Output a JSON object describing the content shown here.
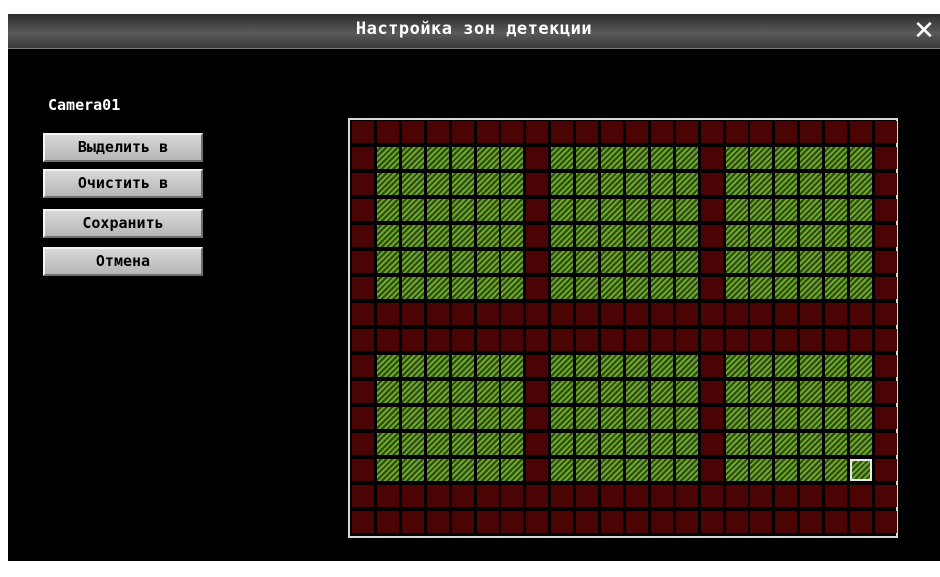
{
  "window": {
    "title": "Настройка зон детекции",
    "close_symbol": "✕"
  },
  "camera": {
    "name": "Camera01"
  },
  "buttons": {
    "select_all": "Выделить в",
    "clear_all": "Очистить в",
    "save": "Сохранить",
    "cancel": "Отмена"
  },
  "colors": {
    "active_cell": "#6ea82a",
    "inactive_cell": "#4a0404",
    "background": "#000000",
    "cursor": "#e8e8e8"
  },
  "detection_grid": {
    "columns": 22,
    "rows": 16,
    "active_zones": [
      {
        "cols": [
          1,
          6
        ],
        "rows": [
          1,
          6
        ]
      },
      {
        "cols": [
          8,
          13
        ],
        "rows": [
          1,
          6
        ]
      },
      {
        "cols": [
          15,
          20
        ],
        "rows": [
          1,
          6
        ]
      },
      {
        "cols": [
          1,
          6
        ],
        "rows": [
          9,
          13
        ]
      },
      {
        "cols": [
          8,
          13
        ],
        "rows": [
          9,
          13
        ]
      },
      {
        "cols": [
          15,
          20
        ],
        "rows": [
          9,
          13
        ]
      }
    ],
    "cursor_cell": {
      "col": 20,
      "row": 13
    }
  }
}
